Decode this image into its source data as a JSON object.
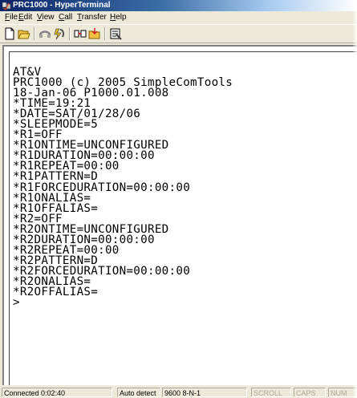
{
  "window": {
    "title": "PRC1000 - HyperTerminal"
  },
  "menu": [
    {
      "key": "F",
      "rest": "ile"
    },
    {
      "key": "E",
      "rest": "dit"
    },
    {
      "key": "V",
      "rest": "iew"
    },
    {
      "key": "C",
      "rest": "all"
    },
    {
      "key": "T",
      "rest": "ransfer"
    },
    {
      "key": "H",
      "rest": "elp"
    }
  ],
  "toolbar": {
    "icons": [
      "new-icon",
      "open-icon",
      "disconnect-icon",
      "dial-icon",
      "send-icon",
      "receive-icon",
      "properties-icon"
    ]
  },
  "terminal": {
    "lines": [
      "AT&V",
      "PRC1000 (c) 2005 SimpleComTools",
      "18-Jan-06 P1000.01.008",
      "*TIME=19:21",
      "*DATE=SAT/01/28/06",
      "*SLEEPMODE=5",
      "*R1=OFF",
      "*R1ONTIME=UNCONFIGURED",
      "*R1DURATION=00:00:00",
      "*R1REPEAT=00:00",
      "*R1PATTERN=D",
      "*R1FORCEDURATION=00:00:00",
      "*R1ONALIAS=",
      "*R1OFFALIAS=",
      "*R2=OFF",
      "*R2ONTIME=UNCONFIGURED",
      "*R2DURATION=00:00:00",
      "*R2REPEAT=00:00",
      "*R2PATTERN=D",
      "*R2FORCEDURATION=00:00:00",
      "*R2ONALIAS=",
      "*R2OFFALIAS=",
      ">"
    ]
  },
  "status": {
    "connected": "Connected 0:02:40",
    "detect": "Auto detect",
    "settings": "9600 8-N-1",
    "scroll": "SCROLL",
    "caps": "CAPS",
    "num": "NUM"
  }
}
